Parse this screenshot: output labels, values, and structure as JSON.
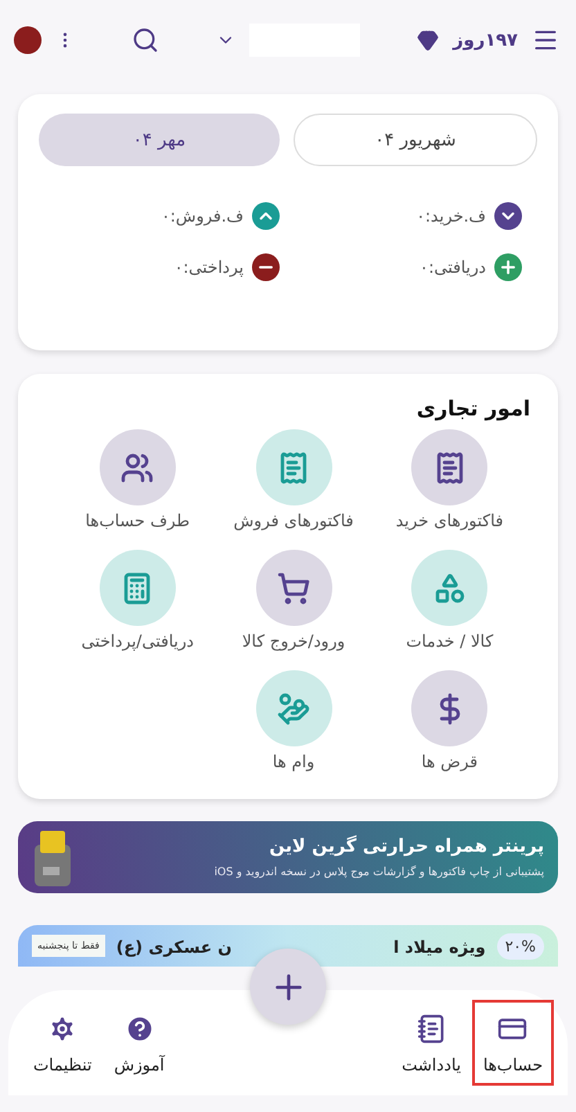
{
  "header": {
    "days": "۱۹۷روز"
  },
  "months": [
    {
      "label": "شهریور ۰۴",
      "selected": false
    },
    {
      "label": "مهر ۰۴",
      "selected": true
    }
  ],
  "stats": [
    {
      "kind": "down",
      "label": "ف.خرید:۰"
    },
    {
      "kind": "up",
      "label": "ف.فروش:۰"
    },
    {
      "kind": "plus",
      "label": "دریافتی:۰"
    },
    {
      "kind": "minus",
      "label": "پرداختی:۰"
    }
  ],
  "business": {
    "title": "امور تجاری",
    "items": [
      {
        "label": "فاکتورهای خرید",
        "kind": "purple"
      },
      {
        "label": "فاکتورهای فروش",
        "kind": "teal"
      },
      {
        "label": "طرف حساب‌ها",
        "kind": "purple"
      },
      {
        "label": "کالا / خدمات",
        "kind": "teal"
      },
      {
        "label": "ورود/خروج کالا",
        "kind": "purple"
      },
      {
        "label": "دریافتی/پرداختی",
        "kind": "teal"
      },
      {
        "label": "قرض ها",
        "kind": "purple"
      },
      {
        "label": "وام ها",
        "kind": "teal"
      }
    ]
  },
  "printer_banner": {
    "title": "پرینتر همراه حرارتی گرین لاین",
    "subtitle": "پشتیبانی از چاپ فاکتورها و گزارشات موج پلاس در نسخه اندروید و iOS"
  },
  "promo_banner": {
    "title_start": "ویژه میلاد ا",
    "title_end": "ن عسکری (ع)",
    "badge": "۲۰%",
    "side_note": "فقط تا پنجشنبه"
  },
  "bottom_nav": [
    {
      "label": "حساب‌ها",
      "selected": true
    },
    {
      "label": "یادداشت",
      "selected": false
    },
    {
      "label": "آموزش",
      "selected": false
    },
    {
      "label": "تنظیمات",
      "selected": false
    }
  ]
}
